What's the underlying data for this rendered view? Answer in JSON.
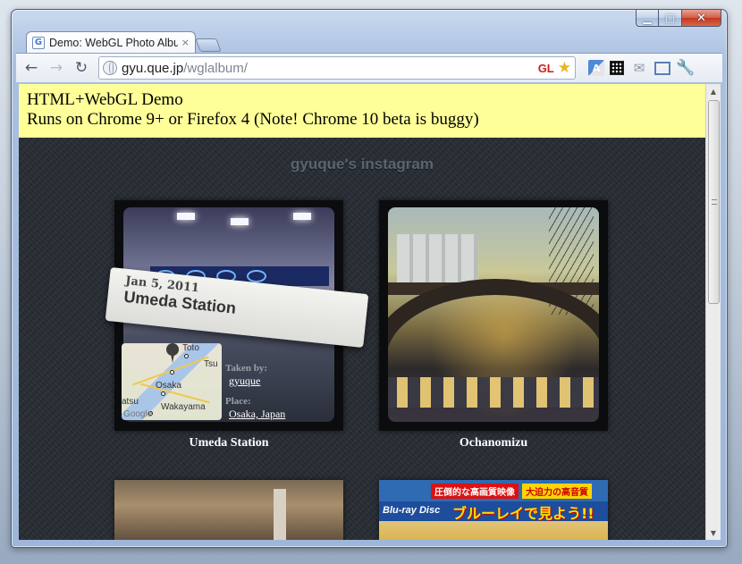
{
  "tabs": [
    {
      "title": "Demo: WebGL Photo Album",
      "close": "×"
    }
  ],
  "window": {
    "minimize": "▁",
    "maximize": "□",
    "close": "✕"
  },
  "toolbar": {
    "back": "←",
    "forward": "→",
    "reload": "↻",
    "url_host": "gyu.que.jp",
    "url_path": "/wglalbum/",
    "gl_badge": "GL",
    "star": "★",
    "translate": "A",
    "mail": "✉",
    "wrench": "🔧"
  },
  "scrollbar": {
    "up": "▲",
    "down": "▼"
  },
  "banner": {
    "line1": "HTML+WebGL Demo",
    "line2": "Runs on Chrome 9+ or Firefox 4 (Note! Chrome 10 beta is buggy)"
  },
  "page": {
    "title": "gyuque's instagram"
  },
  "photos": [
    {
      "caption": "Umeda Station",
      "label_date": "Jan 5, 2011",
      "label_place": "Umeda Station",
      "taken_by_label": "Taken by:",
      "taken_by": "gyuque",
      "place_label": "Place:",
      "place": "Osaka, Japan",
      "map_labels": [
        "Toto",
        "Tsu",
        "Osaka",
        "atsu",
        "Wakayama"
      ],
      "map_provider": "Google"
    },
    {
      "caption": "Ochanomizu"
    }
  ],
  "lower_photo": {
    "promo_red": "圧倒的な高画質映像",
    "promo_yellow": "大迫力の高音質",
    "logo": "Blu-ray Disc",
    "headline": "ブルーレイで見よう!!"
  }
}
